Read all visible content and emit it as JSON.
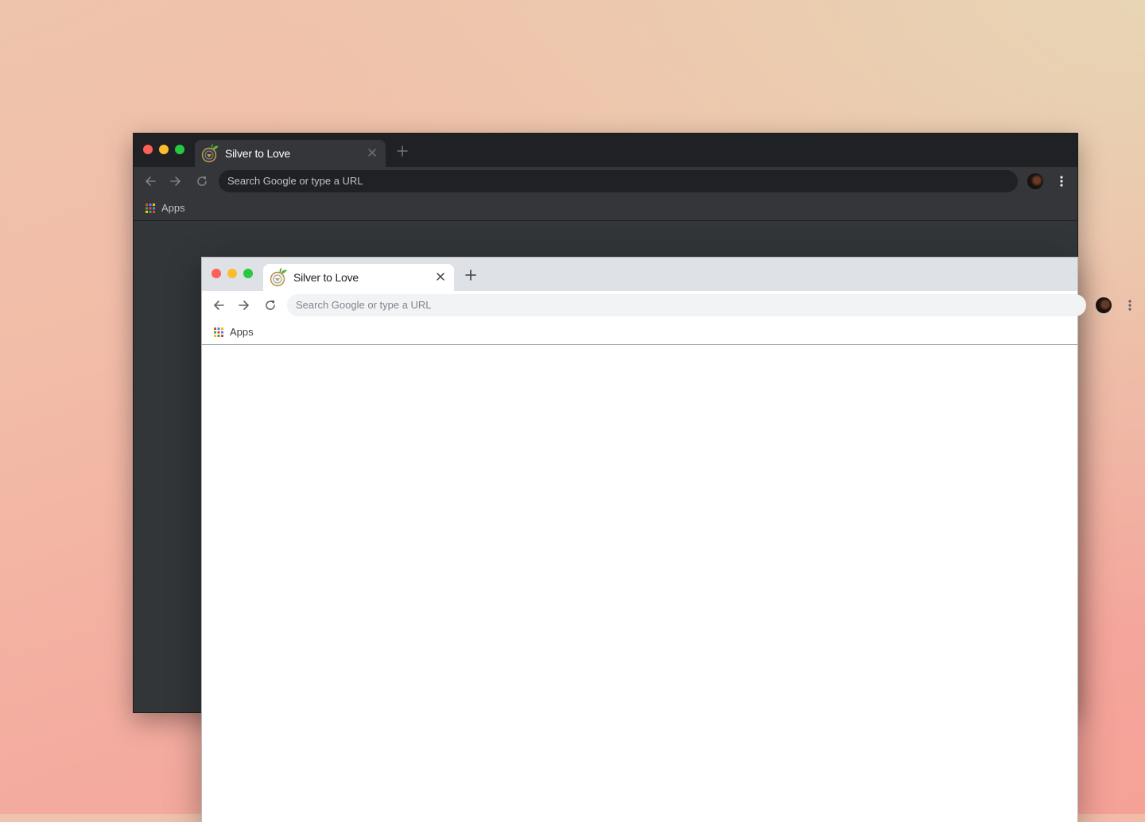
{
  "windows": [
    {
      "theme": "dark",
      "tab_title": "Silver to Love",
      "omnibox_placeholder": "Search Google or type a URL",
      "bookmark_apps_label": "Apps"
    },
    {
      "theme": "light",
      "tab_title": "Silver to Love",
      "omnibox_placeholder": "Search Google or type a URL",
      "bookmark_apps_label": "Apps"
    }
  ],
  "icons": {
    "back": "arrow-left-icon",
    "forward": "arrow-right-icon",
    "reload": "reload-icon",
    "close_tab": "close-icon",
    "new_tab": "plus-icon",
    "menu": "kebab-menu-icon",
    "apps": "apps-grid-icon",
    "favicon": "silver-to-love-logo"
  },
  "colors": {
    "dark_tabstrip": "#202124",
    "dark_toolbar": "#35363a",
    "light_tabstrip": "#dee1e6",
    "light_toolbar": "#ffffff",
    "traffic_red": "#fe5f57",
    "traffic_yellow": "#fdbc2e",
    "traffic_green": "#28c840"
  }
}
